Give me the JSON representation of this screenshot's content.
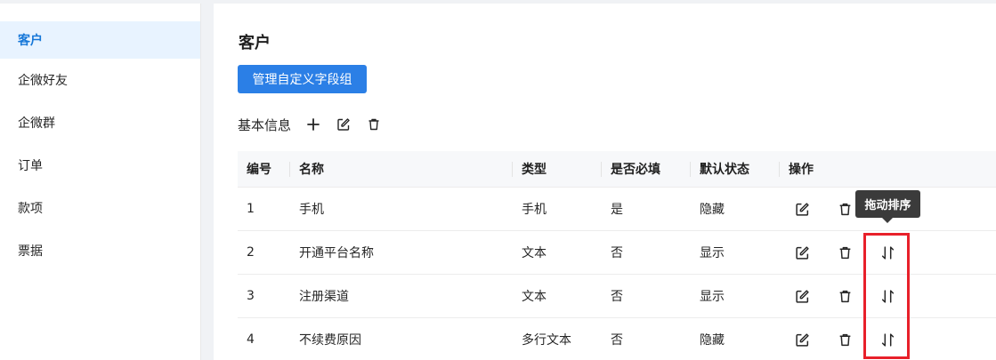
{
  "sidebar": {
    "items": [
      {
        "label": "客户",
        "active": true
      },
      {
        "label": "企微好友"
      },
      {
        "label": "企微群"
      },
      {
        "label": "订单"
      },
      {
        "label": "款项"
      },
      {
        "label": "票据"
      }
    ]
  },
  "main": {
    "title": "客户",
    "manage_button": "管理自定义字段组",
    "group": {
      "name": "基本信息",
      "icons": [
        "plus-icon",
        "edit-icon",
        "trash-icon"
      ]
    },
    "table": {
      "headers": [
        "编号",
        "名称",
        "类型",
        "是否必填",
        "默认状态",
        "操作"
      ],
      "rows": [
        {
          "id": "1",
          "name": "手机",
          "type": "手机",
          "required": "是",
          "status": "隐藏",
          "sortable": false
        },
        {
          "id": "2",
          "name": "开通平台名称",
          "type": "文本",
          "required": "否",
          "status": "显示",
          "sortable": true
        },
        {
          "id": "3",
          "name": "注册渠道",
          "type": "文本",
          "required": "否",
          "status": "显示",
          "sortable": true
        },
        {
          "id": "4",
          "name": "不续费原因",
          "type": "多行文本",
          "required": "否",
          "status": "隐藏",
          "sortable": true
        }
      ]
    },
    "tooltip": "拖动排序"
  },
  "colors": {
    "primary": "#2b7fe6",
    "active_bg": "#e8f3ff",
    "active_text": "#1677d8",
    "highlight": "#e8202a",
    "tooltip_bg": "#3b3b3b"
  }
}
